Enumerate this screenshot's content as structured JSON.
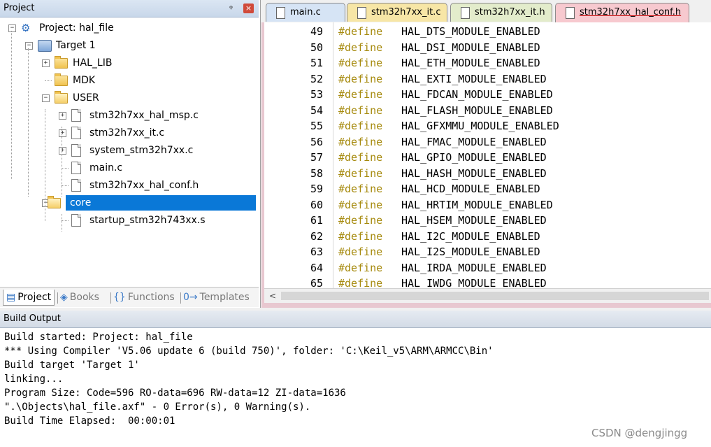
{
  "project_panel": {
    "title": "Project",
    "pin_glyph": "ᵠ",
    "close_glyph": "×",
    "tree": [
      {
        "label": "Project: hal_file",
        "icon": "project-icon",
        "expander": "−"
      },
      {
        "label": "Target 1",
        "icon": "target-icon",
        "expander": "−"
      },
      {
        "label": "HAL_LIB",
        "icon": "folder-closed-icon",
        "expander": "+"
      },
      {
        "label": "MDK",
        "icon": "folder-closed-icon",
        "expander": ""
      },
      {
        "label": "USER",
        "icon": "folder-open-icon",
        "expander": "−"
      },
      {
        "label": "stm32h7xx_hal_msp.c",
        "icon": "file-icon",
        "expander": "+"
      },
      {
        "label": "stm32h7xx_it.c",
        "icon": "file-icon",
        "expander": "+"
      },
      {
        "label": "system_stm32h7xx.c",
        "icon": "file-icon",
        "expander": "+"
      },
      {
        "label": "main.c",
        "icon": "file-icon",
        "expander": ""
      },
      {
        "label": "stm32h7xx_hal_conf.h",
        "icon": "file-icon",
        "expander": ""
      },
      {
        "label": "core",
        "icon": "folder-open-icon",
        "expander": "−",
        "selected": true
      },
      {
        "label": "startup_stm32h743xx.s",
        "icon": "file-icon",
        "expander": ""
      }
    ],
    "tabs": [
      {
        "label": "Project",
        "icon": "project-tab-icon",
        "active": true
      },
      {
        "label": "Books",
        "icon": "books-icon",
        "active": false
      },
      {
        "label": "Functions",
        "icon": "functions-icon",
        "glyph": "{}",
        "active": false
      },
      {
        "label": "Templates",
        "icon": "templates-icon",
        "glyph": "0→",
        "active": false
      }
    ]
  },
  "editor": {
    "tabs": [
      {
        "label": "main.c",
        "color": "#d6e4f5",
        "active": false
      },
      {
        "label": "stm32h7xx_it.c",
        "color": "#f7e6a6",
        "active": false
      },
      {
        "label": "stm32h7xx_it.h",
        "color": "#e3eccb",
        "active": false
      },
      {
        "label": "stm32h7xx_hal_conf.h",
        "color": "#f7c9cf",
        "active": true
      }
    ],
    "keyword": "#define",
    "lines": [
      {
        "n": "49",
        "macro": "HAL_DTS_MODULE_ENABLED"
      },
      {
        "n": "50",
        "macro": "HAL_DSI_MODULE_ENABLED"
      },
      {
        "n": "51",
        "macro": "HAL_ETH_MODULE_ENABLED"
      },
      {
        "n": "52",
        "macro": "HAL_EXTI_MODULE_ENABLED"
      },
      {
        "n": "53",
        "macro": "HAL_FDCAN_MODULE_ENABLED"
      },
      {
        "n": "54",
        "macro": "HAL_FLASH_MODULE_ENABLED"
      },
      {
        "n": "55",
        "macro": "HAL_GFXMMU_MODULE_ENABLED"
      },
      {
        "n": "56",
        "macro": "HAL_FMAC_MODULE_ENABLED"
      },
      {
        "n": "57",
        "macro": "HAL_GPIO_MODULE_ENABLED"
      },
      {
        "n": "58",
        "macro": "HAL_HASH_MODULE_ENABLED"
      },
      {
        "n": "59",
        "macro": "HAL_HCD_MODULE_ENABLED"
      },
      {
        "n": "60",
        "macro": "HAL_HRTIM_MODULE_ENABLED"
      },
      {
        "n": "61",
        "macro": "HAL_HSEM_MODULE_ENABLED"
      },
      {
        "n": "62",
        "macro": "HAL_I2C_MODULE_ENABLED"
      },
      {
        "n": "63",
        "macro": "HAL_I2S_MODULE_ENABLED"
      },
      {
        "n": "64",
        "macro": "HAL_IRDA_MODULE_ENABLED"
      },
      {
        "n": "65",
        "macro": "HAL_IWDG_MODULE_ENABLED"
      }
    ],
    "scroll_left_glyph": "<"
  },
  "build_output": {
    "title": "Build Output",
    "lines": [
      "Build started: Project: hal_file",
      "*** Using Compiler 'V5.06 update 6 (build 750)', folder: 'C:\\Keil_v5\\ARM\\ARMCC\\Bin'",
      "Build target 'Target 1'",
      "linking...",
      "Program Size: Code=596 RO-data=696 RW-data=12 ZI-data=1636",
      "\".\\Objects\\hal_file.axf\" - 0 Error(s), 0 Warning(s).",
      "Build Time Elapsed:  00:00:01"
    ]
  },
  "watermark": "CSDN @dengjingg"
}
